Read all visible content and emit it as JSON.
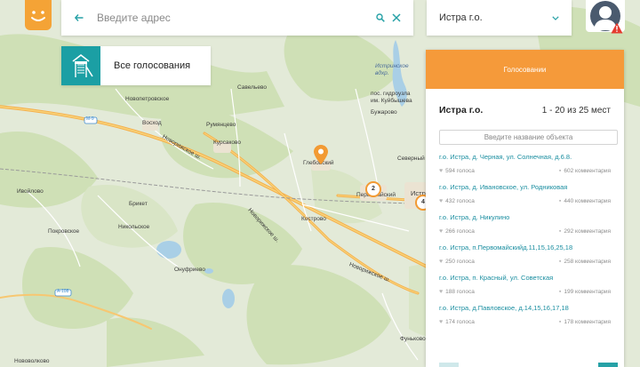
{
  "search": {
    "placeholder": "Введите адрес"
  },
  "region": {
    "selected": "Истра г.о."
  },
  "category": {
    "label": "Все голосования"
  },
  "panel": {
    "header": "Голосовании",
    "title": "Истра г.о.",
    "range": "1 - 20 из 25 мест",
    "filter_placeholder": "Введите название объекта",
    "items": [
      {
        "title": "г.о. Истра, д. Черная, ул. Солнечная, д.6.8.",
        "votes": "594 голоса",
        "comments": "602 комментария"
      },
      {
        "title": "г.о. Истра, д. Ивановское, ул. Родниковая",
        "votes": "432 голоса",
        "comments": "440 комментария"
      },
      {
        "title": "г.о. Истра, д. Никулино",
        "votes": "266 голоса",
        "comments": "292 комментария"
      },
      {
        "title": "г.о. Истра, п.Первомайскийд.11,15,16,25,18",
        "votes": "250 голоса",
        "comments": "258 комментария"
      },
      {
        "title": "г.о. Истра, п. Красный, ул. Советская",
        "votes": "188 голоса",
        "comments": "199 комментария"
      },
      {
        "title": "г.о. Истра, д.Павловское, д.14,15,16,17,18",
        "votes": "174 голоса",
        "comments": "178 комментария"
      }
    ]
  },
  "map": {
    "labels": [
      "Савельево",
      "Новопетровское",
      "Восход",
      "Румянцево",
      "Курсаково",
      "Глебовский",
      "пос. гидроузла им. Куйбышева",
      "Бужарово",
      "Северный",
      "Первомайский",
      "Истра",
      "Кострово",
      "Ивойлово",
      "Брикет",
      "Никольское",
      "Покровское",
      "Онуфриево",
      "Нововолково",
      "Фуньково",
      "Истринское вдхр."
    ],
    "road_labels": [
      "Новорижское ш.",
      "Новорижское ш.",
      "Новорижское ш.",
      "M-9",
      "A-108"
    ],
    "clusters": [
      "2",
      "4"
    ]
  }
}
